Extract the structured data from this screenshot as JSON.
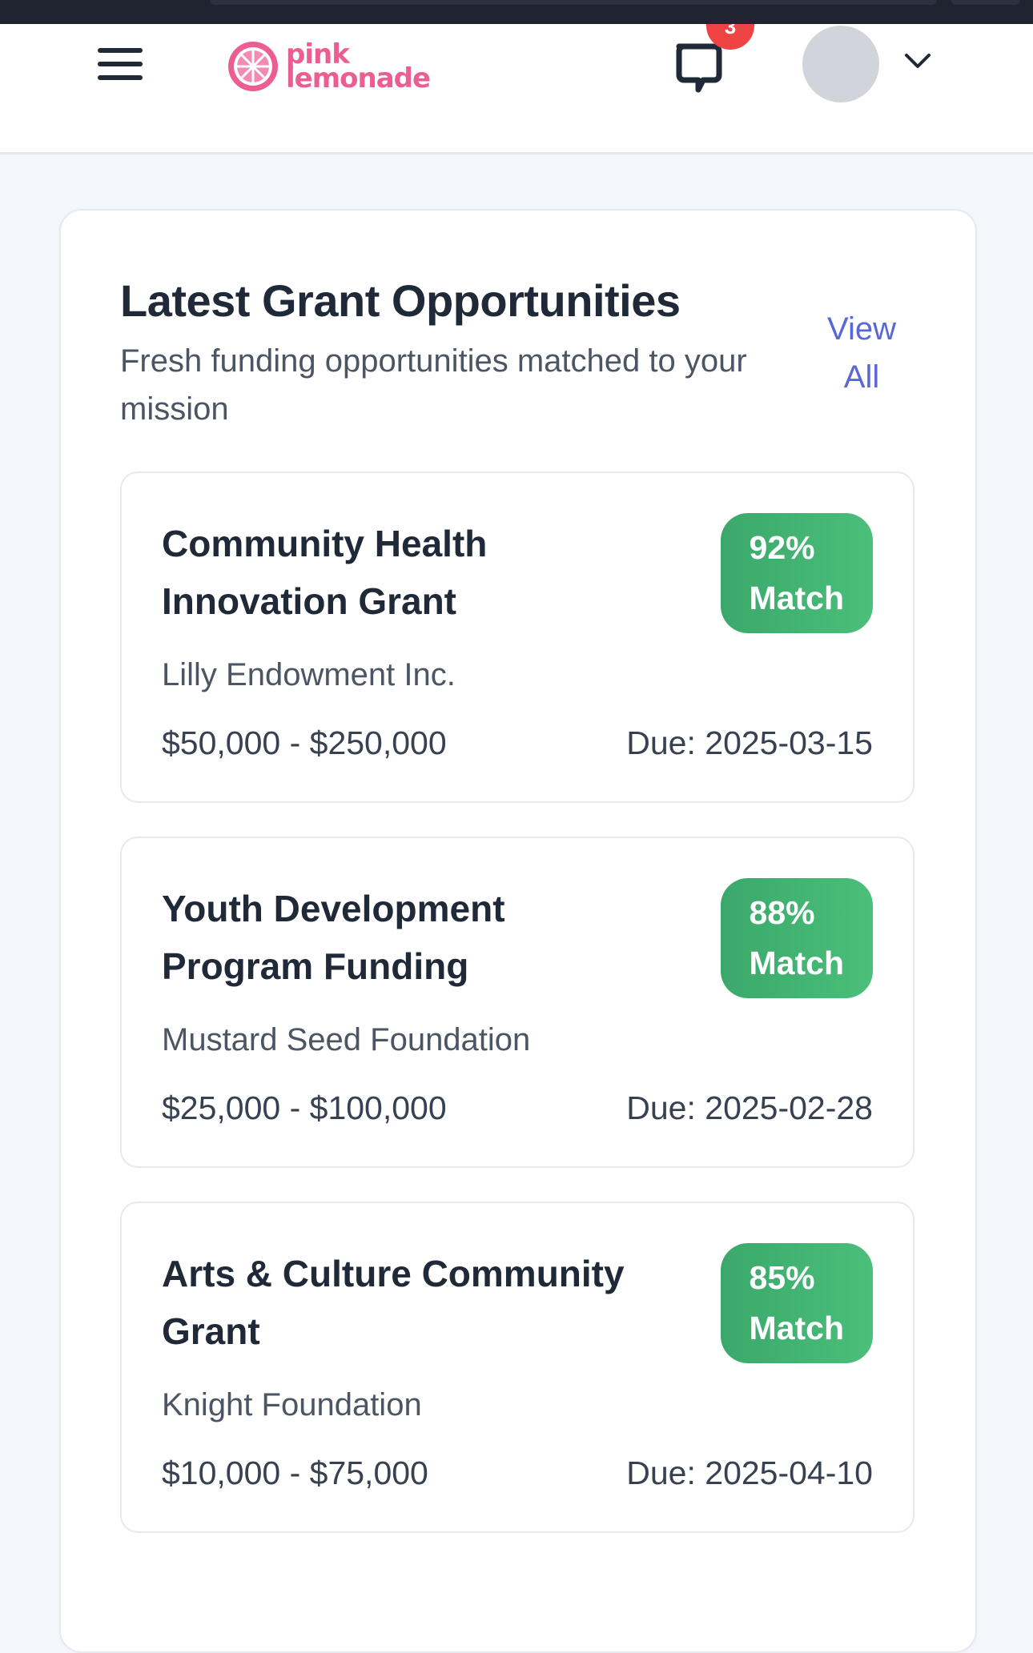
{
  "header": {
    "logo_line1": "pink",
    "logo_line2": "lemonade",
    "notifications_count": "3"
  },
  "section": {
    "title": "Latest Grant Opportunities",
    "subtitle": "Fresh funding opportunities matched to your mission",
    "view_all_line1": "View",
    "view_all_line2": "All"
  },
  "colors": {
    "brand": "#ec5d92",
    "match_badge": "#3fb36f",
    "link": "#5a67d8",
    "notification": "#ef4444"
  },
  "grants": [
    {
      "title": "Community Health Innovation Grant",
      "match_pct": "92%",
      "match_label": "Match",
      "funder": "Lilly Endowment Inc.",
      "amount": "$50,000 - $250,000",
      "due": "Due: 2025-03-15"
    },
    {
      "title": "Youth Development Program Funding",
      "match_pct": "88%",
      "match_label": "Match",
      "funder": "Mustard Seed Foundation",
      "amount": "$25,000 - $100,000",
      "due": "Due: 2025-02-28"
    },
    {
      "title": "Arts & Culture Community Grant",
      "match_pct": "85%",
      "match_label": "Match",
      "funder": "Knight Foundation",
      "amount": "$10,000 - $75,000",
      "due": "Due: 2025-04-10"
    }
  ]
}
